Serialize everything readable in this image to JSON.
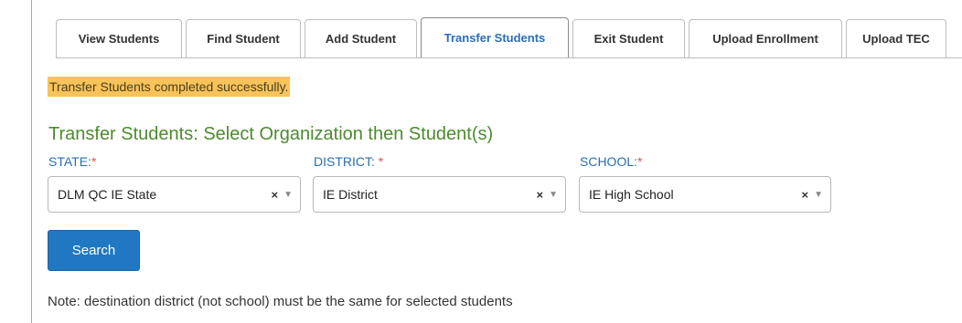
{
  "tabs": [
    {
      "label": "View Students",
      "active": false
    },
    {
      "label": "Find Student",
      "active": false
    },
    {
      "label": "Add Student",
      "active": false
    },
    {
      "label": "Transfer Students",
      "active": true
    },
    {
      "label": "Exit Student",
      "active": false
    },
    {
      "label": "Upload Enrollment",
      "active": false
    },
    {
      "label": "Upload TEC",
      "active": false
    }
  ],
  "success_message": "Transfer Students completed successfully.",
  "section_title": "Transfer Students: Select Organization then Student(s)",
  "fields": {
    "state": {
      "label": "STATE:",
      "required_mark": "*",
      "value": "DLM QC IE State"
    },
    "district": {
      "label": "DISTRICT: ",
      "required_mark": "*",
      "value": "IE District"
    },
    "school": {
      "label": "SCHOOL:",
      "required_mark": "*",
      "value": "IE High School"
    }
  },
  "clear_glyph": "×",
  "caret_glyph": "▼",
  "search_label": "Search",
  "note": "Note: destination district (not school) must be the same for selected students",
  "colors": {
    "accent_blue": "#2a6db5",
    "button_blue": "#1f78c1",
    "success_bg": "#f7c35a",
    "title_green": "#4c8b2e",
    "required_red": "#d9534f"
  }
}
